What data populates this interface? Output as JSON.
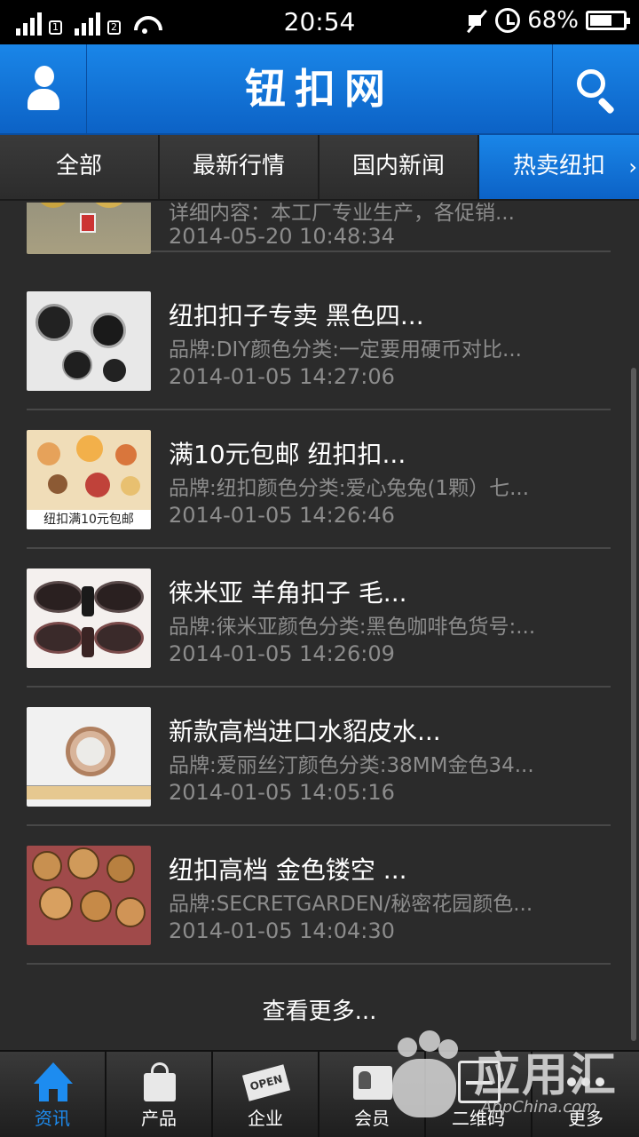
{
  "status_bar": {
    "time": "20:54",
    "sim1": "1",
    "sim2": "2",
    "battery": "68%",
    "battery_level": 0.68,
    "icons": [
      "signal-icon",
      "wifi-icon",
      "mute-icon",
      "alarm-icon",
      "battery-icon"
    ]
  },
  "header": {
    "title": "钮扣网",
    "accent_color": "#1a86e8",
    "icons": [
      "user-icon",
      "search-icon"
    ]
  },
  "tabs": {
    "left_arrow": "‹",
    "right_arrow": "›",
    "items": [
      {
        "label": "全部",
        "active": false
      },
      {
        "label": "最新行情",
        "active": false
      },
      {
        "label": "国内新闻",
        "active": false
      },
      {
        "label": "热卖纽扣",
        "active": true
      }
    ]
  },
  "list": {
    "items": [
      {
        "title": "",
        "desc": "详细内容：本工厂专业生产，各促销...",
        "date": "2014-05-20 10:48:34"
      },
      {
        "title": "纽扣扣子专卖 黑色四...",
        "desc": "品牌:DIY颜色分类:一定要用硬币对比...",
        "date": "2014-01-05 14:27:06"
      },
      {
        "title": "满10元包邮 纽扣扣...",
        "desc": "品牌:纽扣颜色分类:爱心兔兔(1颗）七...",
        "date": "2014-01-05 14:26:46",
        "thumb_caption": "纽扣满10元包邮"
      },
      {
        "title": "徕米亚 羊角扣子 毛...",
        "desc": "品牌:徕米亚颜色分类:黑色咖啡色货号:...",
        "date": "2014-01-05 14:26:09"
      },
      {
        "title": "新款高档进口水貂皮水...",
        "desc": "品牌:爱丽丝汀颜色分类:38MM金色34...",
        "date": "2014-01-05 14:05:16"
      },
      {
        "title": "纽扣高档 金色镂空 ...",
        "desc": "品牌:SECRETGARDEN/秘密花园颜色...",
        "date": "2014-01-05 14:04:30"
      }
    ],
    "more_label": "查看更多..."
  },
  "bottom_nav": {
    "items": [
      {
        "label": "资讯",
        "icon": "home-icon",
        "active": true
      },
      {
        "label": "产品",
        "icon": "shopping-bag-icon",
        "active": false
      },
      {
        "label": "企业",
        "icon": "open-sign-icon",
        "active": false
      },
      {
        "label": "会员",
        "icon": "member-card-icon",
        "active": false
      },
      {
        "label": "二维码",
        "icon": "qr-code-icon",
        "active": false
      },
      {
        "label": "更多",
        "icon": "more-dots-icon",
        "active": false
      }
    ]
  },
  "watermark": {
    "text": "应用汇",
    "sub": "AppChina.com"
  }
}
